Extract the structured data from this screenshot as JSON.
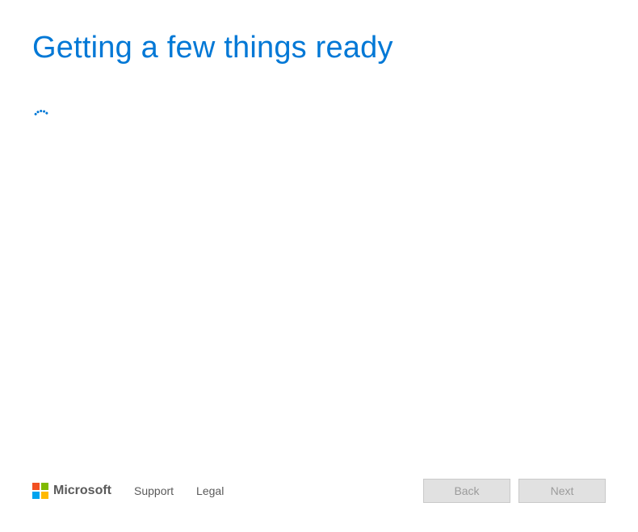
{
  "header": {
    "title": "Getting a few things ready"
  },
  "footer": {
    "brand": "Microsoft",
    "links": {
      "support": "Support",
      "legal": "Legal"
    },
    "buttons": {
      "back": "Back",
      "next": "Next"
    }
  },
  "colors": {
    "accent": "#0178D6"
  }
}
